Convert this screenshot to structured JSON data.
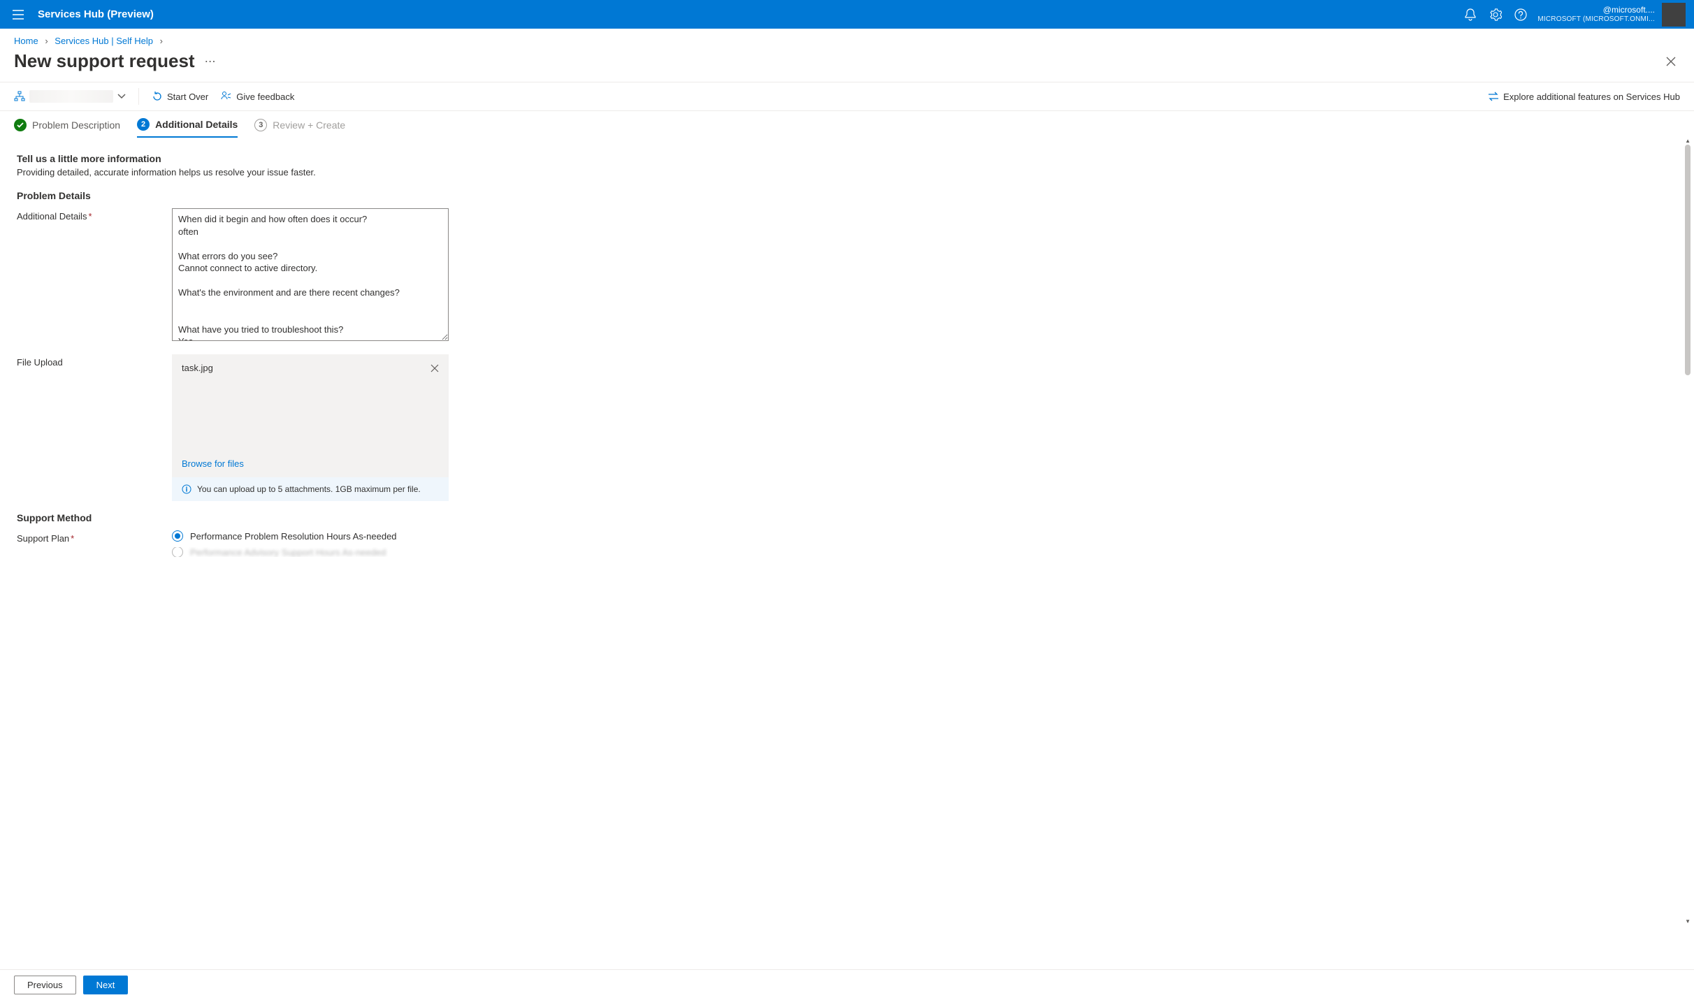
{
  "topbar": {
    "title": "Services Hub (Preview)",
    "account_top": "@microsoft....",
    "account_bottom": "MICROSOFT (MICROSOFT.ONMI..."
  },
  "breadcrumb": {
    "home": "Home",
    "hub": "Services Hub | Self Help"
  },
  "header": {
    "title": "New support request"
  },
  "actionbar": {
    "start_over": "Start Over",
    "give_feedback": "Give feedback",
    "explore": "Explore additional features on Services Hub"
  },
  "steps": {
    "s1": "Problem Description",
    "s2": "Additional Details",
    "s3": "Review + Create",
    "s2_num": "2",
    "s3_num": "3"
  },
  "section": {
    "heading": "Tell us a little more information",
    "sub": "Providing detailed, accurate information helps us resolve your issue faster.",
    "problem_details": "Problem Details",
    "additional_details_label": "Additional Details",
    "additional_details_value": "When did it begin and how often does it occur?\noften\n\nWhat errors do you see?\nCannot connect to active directory.\n\nWhat's the environment and are there recent changes?\n\n\nWhat have you tried to troubleshoot this?\nYes",
    "file_upload_label": "File Upload",
    "uploaded_file": "task.jpg",
    "browse": "Browse for files",
    "upload_info": "You can upload up to 5 attachments. 1GB maximum per file.",
    "support_method": "Support Method",
    "support_plan_label": "Support Plan",
    "plan_option_1": "Performance Problem Resolution Hours As-needed"
  },
  "footer": {
    "prev": "Previous",
    "next": "Next"
  }
}
